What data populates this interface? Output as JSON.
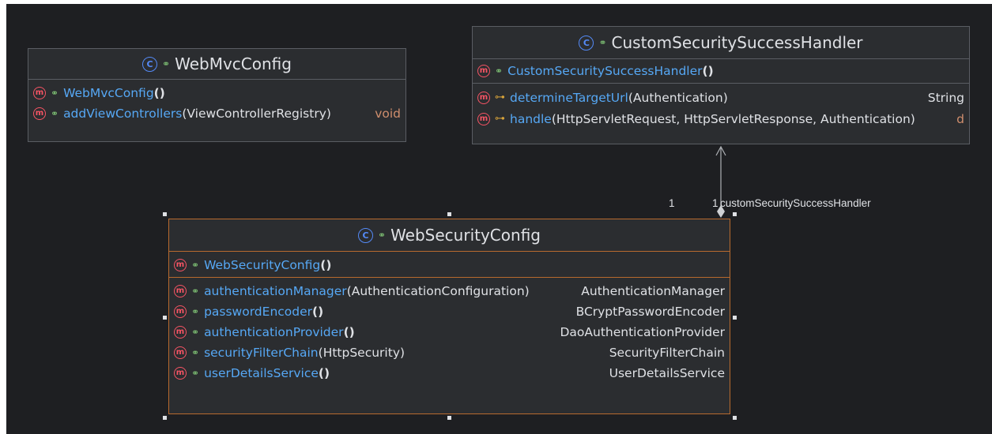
{
  "classes": {
    "webmvc": {
      "name": "WebMvcConfig",
      "methods": [
        {
          "name": "WebMvcConfig",
          "params": "",
          "type": "",
          "kw": false
        },
        {
          "name": "addViewControllers",
          "params": "ViewControllerRegistry",
          "type": "void",
          "kw": true
        }
      ]
    },
    "handler": {
      "name": "CustomSecuritySuccessHandler",
      "constructor": {
        "name": "CustomSecuritySuccessHandler",
        "params": ""
      },
      "methods": [
        {
          "name": "determineTargetUrl",
          "params": "Authentication",
          "type": "String",
          "kw": false
        },
        {
          "name": "handle",
          "params": "HttpServletRequest, HttpServletResponse, Authentication",
          "type": "d",
          "kw": true
        }
      ]
    },
    "websec": {
      "name": "WebSecurityConfig",
      "constructor": {
        "name": "WebSecurityConfig",
        "params": ""
      },
      "methods": [
        {
          "name": "authenticationManager",
          "params": "AuthenticationConfiguration ",
          "type": "AuthenticationManager",
          "kw": false
        },
        {
          "name": "passwordEncoder",
          "params": "",
          "type": "BCryptPasswordEncoder",
          "kw": false
        },
        {
          "name": "authenticationProvider",
          "params": "",
          "type": "DaoAuthenticationProvider",
          "kw": false
        },
        {
          "name": "securityFilterChain",
          "params": "HttpSecurity",
          "type": "SecurityFilterChain",
          "kw": false
        },
        {
          "name": "userDetailsService",
          "params": "",
          "type": "UserDetailsService",
          "kw": false
        }
      ]
    }
  },
  "relation": {
    "source_multiplicity": "1",
    "target_multiplicity": "1",
    "role": "customSecuritySuccessHandler"
  },
  "colors": {
    "background": "#1e1f22",
    "class_fill": "#2b2d30",
    "border": "#5a5d63",
    "selected_border": "#b86a2e",
    "method_name": "#56a8f5",
    "keyword": "#cf8e6d"
  },
  "icons": {
    "class": "class-icon",
    "method": "method-icon",
    "public": "public-icon",
    "protected": "key-icon"
  }
}
